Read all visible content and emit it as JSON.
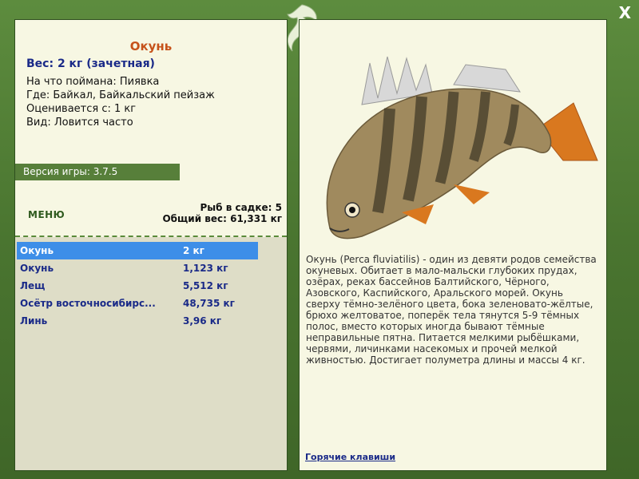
{
  "window": {
    "close_label": "X"
  },
  "fish": {
    "title": "Окунь",
    "weight": "Вес: 2 кг (зачетная)",
    "caught_on": "На что поймана: Пиявка",
    "where": "Где: Байкал, Байкальский пейзаж",
    "rated_from": "Оценивается с: 1 кг",
    "kind": "Вид: Ловится часто"
  },
  "version": "Версия игры: 3.7.5",
  "menu_label": "МЕНЮ",
  "cage": {
    "count": "Рыб в садке: 5",
    "total": "Общий вес: 61,331 кг"
  },
  "catch_list": [
    {
      "name": "Окунь",
      "weight": "2 кг",
      "selected": true
    },
    {
      "name": "Окунь",
      "weight": "1,123 кг",
      "selected": false
    },
    {
      "name": "Лещ",
      "weight": "5,512 кг",
      "selected": false
    },
    {
      "name": "Осётр восточносибирс...",
      "weight": "48,735 кг",
      "selected": false
    },
    {
      "name": "Линь",
      "weight": "3,96 кг",
      "selected": false
    }
  ],
  "description": "Окунь (Perca fluviatilis) - один из девяти родов семейства окуневых. Обитает в мало-мальски глубоких прудах, озёрах, реках бассейнов Балтийского, Чёрного, Азовского, Каспийского, Аральского морей. Окунь сверху тёмно-зелёного цвета, бока зеленовато-жёлтые, брюхо желтоватое, поперёк тела тянутся 5-9 тёмных полос, вместо которых иногда бывают тёмные неправильные пятна. Питается мелкими рыбёшками, червями, личинками насекомых и прочей мелкой живностью. Достигает полуметра длины и массы 4 кг.",
  "hotkeys_label": "Горячие клавиши",
  "colors": {
    "accent_green": "#577f3a",
    "selection_blue": "#3d8ee8",
    "title_orange": "#c6521a",
    "text_navy": "#1a2a88"
  }
}
